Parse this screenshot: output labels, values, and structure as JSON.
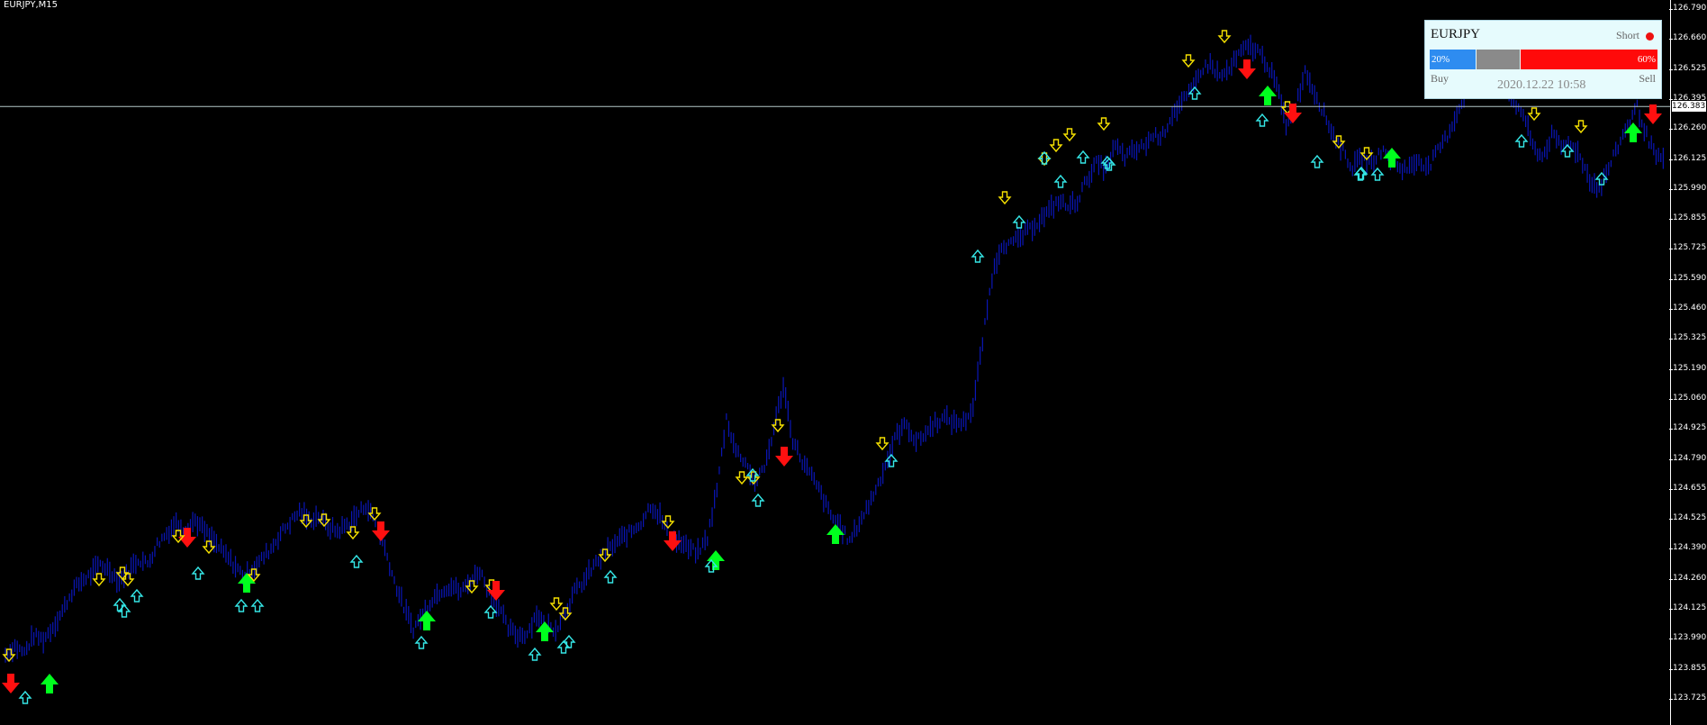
{
  "chart": {
    "symbol_timeframe": "EURJPY,M15",
    "current_price": "126.383",
    "price_ticks": [
      "126.790",
      "126.660",
      "126.525",
      "126.395",
      "126.260",
      "126.125",
      "125.990",
      "125.855",
      "125.725",
      "125.590",
      "125.460",
      "125.325",
      "125.190",
      "125.060",
      "124.925",
      "124.790",
      "124.655",
      "124.525",
      "124.390",
      "124.260",
      "124.125",
      "123.990",
      "123.855",
      "123.725"
    ],
    "colors": {
      "background": "#000000",
      "candles": "#0a16b8",
      "big_up": "#00ff1e",
      "big_down": "#ff1010",
      "small_down": "#f5e000",
      "small_up": "#35e6e6",
      "price_line": "#b4c8c8"
    }
  },
  "chart_data": {
    "type": "line",
    "series": [
      {
        "values": [
          123.86,
          123.9,
          123.87,
          123.95,
          123.93,
          123.99,
          124.06,
          124.15,
          124.2,
          124.23,
          124.28,
          124.25,
          124.2,
          124.25,
          124.3,
          124.28,
          124.37,
          124.42,
          124.47,
          124.44,
          124.48,
          124.43,
          124.38,
          124.33,
          124.28,
          124.23,
          124.25,
          124.3,
          124.35,
          124.42,
          124.47,
          124.52,
          124.48,
          124.5,
          124.45,
          124.43,
          124.46,
          124.5,
          124.55,
          124.47,
          124.35,
          124.2,
          124.08,
          123.98,
          124.05,
          124.12,
          124.16,
          124.18,
          124.15,
          124.2,
          124.25,
          124.15,
          124.08,
          123.98,
          123.95,
          123.96,
          124.05,
          124.0,
          123.98,
          124.06,
          124.15,
          124.2,
          124.27,
          124.32,
          124.36,
          124.4,
          124.43,
          124.47,
          124.55,
          124.5,
          124.4,
          124.38,
          124.35,
          124.33,
          124.4,
          124.62,
          124.95,
          124.8,
          124.75,
          124.65,
          124.72,
          124.9,
          125.1,
          124.85,
          124.75,
          124.68,
          124.6,
          124.5,
          124.45,
          124.38,
          124.47,
          124.55,
          124.65,
          124.76,
          124.88,
          124.92,
          124.84,
          124.88,
          124.93,
          124.95,
          124.93,
          124.93,
          125.0,
          125.3,
          125.6,
          125.75,
          125.75,
          125.78,
          125.82,
          125.86,
          125.9,
          125.95,
          125.92,
          125.95,
          126.05,
          126.12,
          126.1,
          126.2,
          126.15,
          126.18,
          126.2,
          126.25,
          126.25,
          126.35,
          126.4,
          126.45,
          126.55,
          126.58,
          126.52,
          126.55,
          126.62,
          126.66,
          126.64,
          126.58,
          126.48,
          126.3,
          126.38,
          126.55,
          126.45,
          126.35,
          126.25,
          126.18,
          126.1,
          126.15,
          126.12,
          126.18,
          126.15,
          126.1,
          126.1,
          126.14,
          126.1,
          126.18,
          126.25,
          126.35,
          126.45,
          126.52,
          126.55,
          126.55,
          126.45,
          126.4,
          126.35,
          126.2,
          126.15,
          126.25,
          126.2,
          126.22,
          126.15,
          126.05,
          126.0,
          126.1,
          126.2,
          126.3,
          126.38,
          126.25,
          126.15,
          126.12
        ]
      }
    ],
    "ylim": [
      123.65,
      126.84
    ],
    "xlabel": "",
    "ylabel": ""
  },
  "signals": [
    {
      "x": 12,
      "y": 758,
      "kind": "big_down"
    },
    {
      "x": 55,
      "y": 760,
      "kind": "big_up"
    },
    {
      "x": 10,
      "y": 727,
      "kind": "small_down"
    },
    {
      "x": 28,
      "y": 775,
      "kind": "small_up"
    },
    {
      "x": 110,
      "y": 643,
      "kind": "small_down"
    },
    {
      "x": 136,
      "y": 636,
      "kind": "small_down"
    },
    {
      "x": 142,
      "y": 643,
      "kind": "small_down"
    },
    {
      "x": 133,
      "y": 672,
      "kind": "small_up"
    },
    {
      "x": 138,
      "y": 679,
      "kind": "small_up"
    },
    {
      "x": 152,
      "y": 662,
      "kind": "small_up"
    },
    {
      "x": 208,
      "y": 596,
      "kind": "big_down"
    },
    {
      "x": 198,
      "y": 595,
      "kind": "small_down"
    },
    {
      "x": 232,
      "y": 607,
      "kind": "small_down"
    },
    {
      "x": 220,
      "y": 637,
      "kind": "small_up"
    },
    {
      "x": 274,
      "y": 648,
      "kind": "big_up"
    },
    {
      "x": 268,
      "y": 673,
      "kind": "small_up"
    },
    {
      "x": 286,
      "y": 673,
      "kind": "small_up"
    },
    {
      "x": 282,
      "y": 638,
      "kind": "small_down"
    },
    {
      "x": 340,
      "y": 578,
      "kind": "small_down"
    },
    {
      "x": 360,
      "y": 577,
      "kind": "small_down"
    },
    {
      "x": 392,
      "y": 591,
      "kind": "small_down"
    },
    {
      "x": 416,
      "y": 570,
      "kind": "small_down"
    },
    {
      "x": 423,
      "y": 589,
      "kind": "big_down"
    },
    {
      "x": 396,
      "y": 624,
      "kind": "small_up"
    },
    {
      "x": 474,
      "y": 690,
      "kind": "big_up"
    },
    {
      "x": 468,
      "y": 714,
      "kind": "small_up"
    },
    {
      "x": 524,
      "y": 651,
      "kind": "small_down"
    },
    {
      "x": 546,
      "y": 650,
      "kind": "small_down"
    },
    {
      "x": 551,
      "y": 655,
      "kind": "big_down"
    },
    {
      "x": 545,
      "y": 680,
      "kind": "small_up"
    },
    {
      "x": 605,
      "y": 702,
      "kind": "big_up"
    },
    {
      "x": 594,
      "y": 727,
      "kind": "small_up"
    },
    {
      "x": 618,
      "y": 670,
      "kind": "small_down"
    },
    {
      "x": 628,
      "y": 681,
      "kind": "small_down"
    },
    {
      "x": 626,
      "y": 719,
      "kind": "small_up"
    },
    {
      "x": 632,
      "y": 713,
      "kind": "small_up"
    },
    {
      "x": 672,
      "y": 616,
      "kind": "small_down"
    },
    {
      "x": 678,
      "y": 641,
      "kind": "small_up"
    },
    {
      "x": 742,
      "y": 579,
      "kind": "small_down"
    },
    {
      "x": 747,
      "y": 600,
      "kind": "big_down"
    },
    {
      "x": 795,
      "y": 623,
      "kind": "big_up"
    },
    {
      "x": 790,
      "y": 629,
      "kind": "small_up"
    },
    {
      "x": 824,
      "y": 530,
      "kind": "small_down"
    },
    {
      "x": 837,
      "y": 530,
      "kind": "small_down"
    },
    {
      "x": 836,
      "y": 528,
      "kind": "small_up"
    },
    {
      "x": 842,
      "y": 556,
      "kind": "small_up"
    },
    {
      "x": 864,
      "y": 472,
      "kind": "small_down"
    },
    {
      "x": 871,
      "y": 506,
      "kind": "big_down"
    },
    {
      "x": 928,
      "y": 594,
      "kind": "big_up"
    },
    {
      "x": 980,
      "y": 492,
      "kind": "small_down"
    },
    {
      "x": 990,
      "y": 512,
      "kind": "small_up"
    },
    {
      "x": 1086,
      "y": 285,
      "kind": "small_up"
    },
    {
      "x": 1116,
      "y": 219,
      "kind": "small_down"
    },
    {
      "x": 1132,
      "y": 247,
      "kind": "small_up"
    },
    {
      "x": 1160,
      "y": 176,
      "kind": "small_down"
    },
    {
      "x": 1173,
      "y": 161,
      "kind": "small_down"
    },
    {
      "x": 1188,
      "y": 149,
      "kind": "small_down"
    },
    {
      "x": 1160,
      "y": 176,
      "kind": "small_up"
    },
    {
      "x": 1178,
      "y": 202,
      "kind": "small_up"
    },
    {
      "x": 1203,
      "y": 175,
      "kind": "small_up"
    },
    {
      "x": 1226,
      "y": 137,
      "kind": "small_down"
    },
    {
      "x": 1230,
      "y": 181,
      "kind": "small_up"
    },
    {
      "x": 1232,
      "y": 183,
      "kind": "small_up"
    },
    {
      "x": 1320,
      "y": 67,
      "kind": "small_down"
    },
    {
      "x": 1327,
      "y": 104,
      "kind": "small_up"
    },
    {
      "x": 1360,
      "y": 40,
      "kind": "small_down"
    },
    {
      "x": 1385,
      "y": 76,
      "kind": "big_down"
    },
    {
      "x": 1408,
      "y": 107,
      "kind": "big_up"
    },
    {
      "x": 1402,
      "y": 134,
      "kind": "small_up"
    },
    {
      "x": 1430,
      "y": 119,
      "kind": "small_down"
    },
    {
      "x": 1436,
      "y": 125,
      "kind": "big_down"
    },
    {
      "x": 1463,
      "y": 180,
      "kind": "small_up"
    },
    {
      "x": 1487,
      "y": 157,
      "kind": "small_down"
    },
    {
      "x": 1511,
      "y": 194,
      "kind": "small_up"
    },
    {
      "x": 1518,
      "y": 170,
      "kind": "small_down"
    },
    {
      "x": 1512,
      "y": 193,
      "kind": "small_up"
    },
    {
      "x": 1530,
      "y": 194,
      "kind": "small_up"
    },
    {
      "x": 1546,
      "y": 176,
      "kind": "big_up"
    },
    {
      "x": 1704,
      "y": 126,
      "kind": "small_down"
    },
    {
      "x": 1690,
      "y": 157,
      "kind": "small_up"
    },
    {
      "x": 1741,
      "y": 168,
      "kind": "small_up"
    },
    {
      "x": 1756,
      "y": 140,
      "kind": "small_down"
    },
    {
      "x": 1779,
      "y": 199,
      "kind": "small_up"
    },
    {
      "x": 1814,
      "y": 148,
      "kind": "big_up"
    },
    {
      "x": 1836,
      "y": 126,
      "kind": "big_down"
    }
  ],
  "panel": {
    "symbol": "EURJPY",
    "direction": "Short",
    "buy_pct": "20%",
    "sell_pct": "60%",
    "buy_label": "Buy",
    "sell_label": "Sell",
    "timestamp": "2020.12.22 10:58",
    "colors": {
      "buy": "#2e8cf0",
      "neutral": "#8a8a8a",
      "sell": "#ff0a0a",
      "dot": "#ee1111"
    }
  }
}
